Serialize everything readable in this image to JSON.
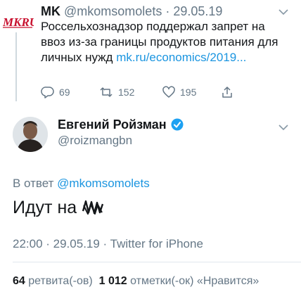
{
  "parent_tweet": {
    "logo_text": "MKRU",
    "name": "MK",
    "handle": "@mkomsomolets",
    "separator": " · ",
    "date": "29.05.19",
    "text": "Россельхознадзор поддержал запрет на ввоз из-за границы продуктов питания для личных нужд ",
    "link": "mk.ru/economics/2019...",
    "replies": "69",
    "retweets": "152",
    "likes": "195"
  },
  "main_tweet": {
    "name": "Евгений Ройзман",
    "handle": "@roizmangbn",
    "reply_prefix": "В ответ ",
    "reply_handle": "@mkomsomolets",
    "text": "Идут на",
    "meta": "22:00 · 29.05.19 · Twitter for iPhone",
    "retweets_count": "64",
    "retweets_label": " ретвита(-ов)",
    "likes_count": "1 012",
    "likes_label": " отметки(-ок) «Нравится»"
  },
  "colors": {
    "link": "#1b95e0",
    "verified": "#1da1f2",
    "secondary": "#657786",
    "logo_red": "#c8102e"
  }
}
